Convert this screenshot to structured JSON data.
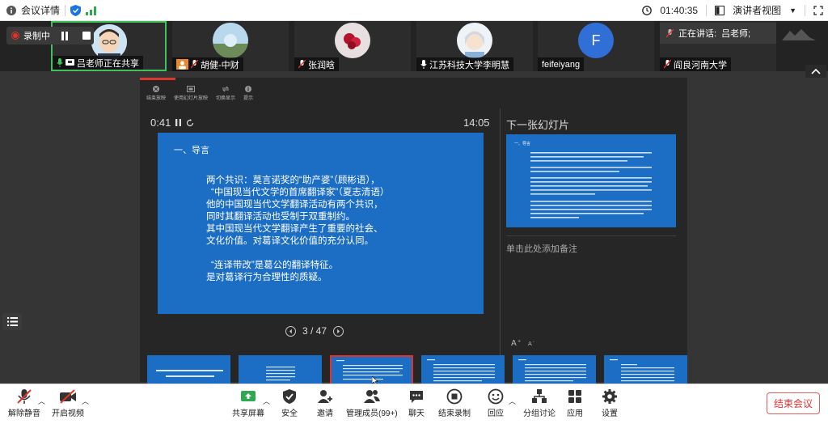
{
  "titlebar": {
    "meeting_details": "会议详情",
    "timer": "01:40:35",
    "view_mode": "演讲者视图"
  },
  "recording": {
    "label": "录制中"
  },
  "speaking": {
    "label": "正在讲话:",
    "name": "吕老师;"
  },
  "participants": [
    {
      "name": "吕老师正在共享"
    },
    {
      "name": "胡健-中财"
    },
    {
      "name": "张润晗"
    },
    {
      "name": "江苏科技大学李明慧"
    },
    {
      "name": "feifeiyang",
      "initial": "F"
    },
    {
      "name": "阎良河南大学"
    }
  ],
  "presenter": {
    "toolbar": [
      "结束放映",
      "使用幻灯片放映",
      "切换显示",
      "提示"
    ],
    "elapsed": "0:41",
    "clock": "14:05",
    "next_slide_title": "下一张幻灯片",
    "notes_placeholder": "单击此处添加备注",
    "page_indicator": "3 / 47"
  },
  "slide": {
    "title": "一、导言",
    "lines": [
      "两个共识：莫言诺奖的“助产婆”（顾彬语），",
      "“中国现当代文学的首席翻译家”（夏志清语）",
      "他的中国现当代文学翻译活动有两个共识，",
      "同时其翻译活动也受制于双重制约。",
      "其中国现当代文学翻译产生了重要的社会、",
      "文化价值。对葛译文化价值的充分认同。",
      "",
      "“连译带改”是葛公的翻译特征。",
      "是对葛译行为合理性的质疑。"
    ]
  },
  "next_slide": {
    "title": "一、导言"
  },
  "controls": {
    "unmute": "解除静音",
    "start_video": "开启视频",
    "share_screen": "共享屏幕",
    "security": "安全",
    "invite": "邀请",
    "manage_participants": "管理成员(99+)",
    "chat": "聊天",
    "end_recording": "结束录制",
    "reactions": "回应",
    "breakout": "分组讨论",
    "apps": "应用",
    "settings": "设置",
    "end_meeting": "结束会议"
  },
  "colors": {
    "slide_blue": "#1c6ec5",
    "recording_red": "#e0332b",
    "end_red": "#e03030",
    "speaking_green": "#3fc25b"
  }
}
